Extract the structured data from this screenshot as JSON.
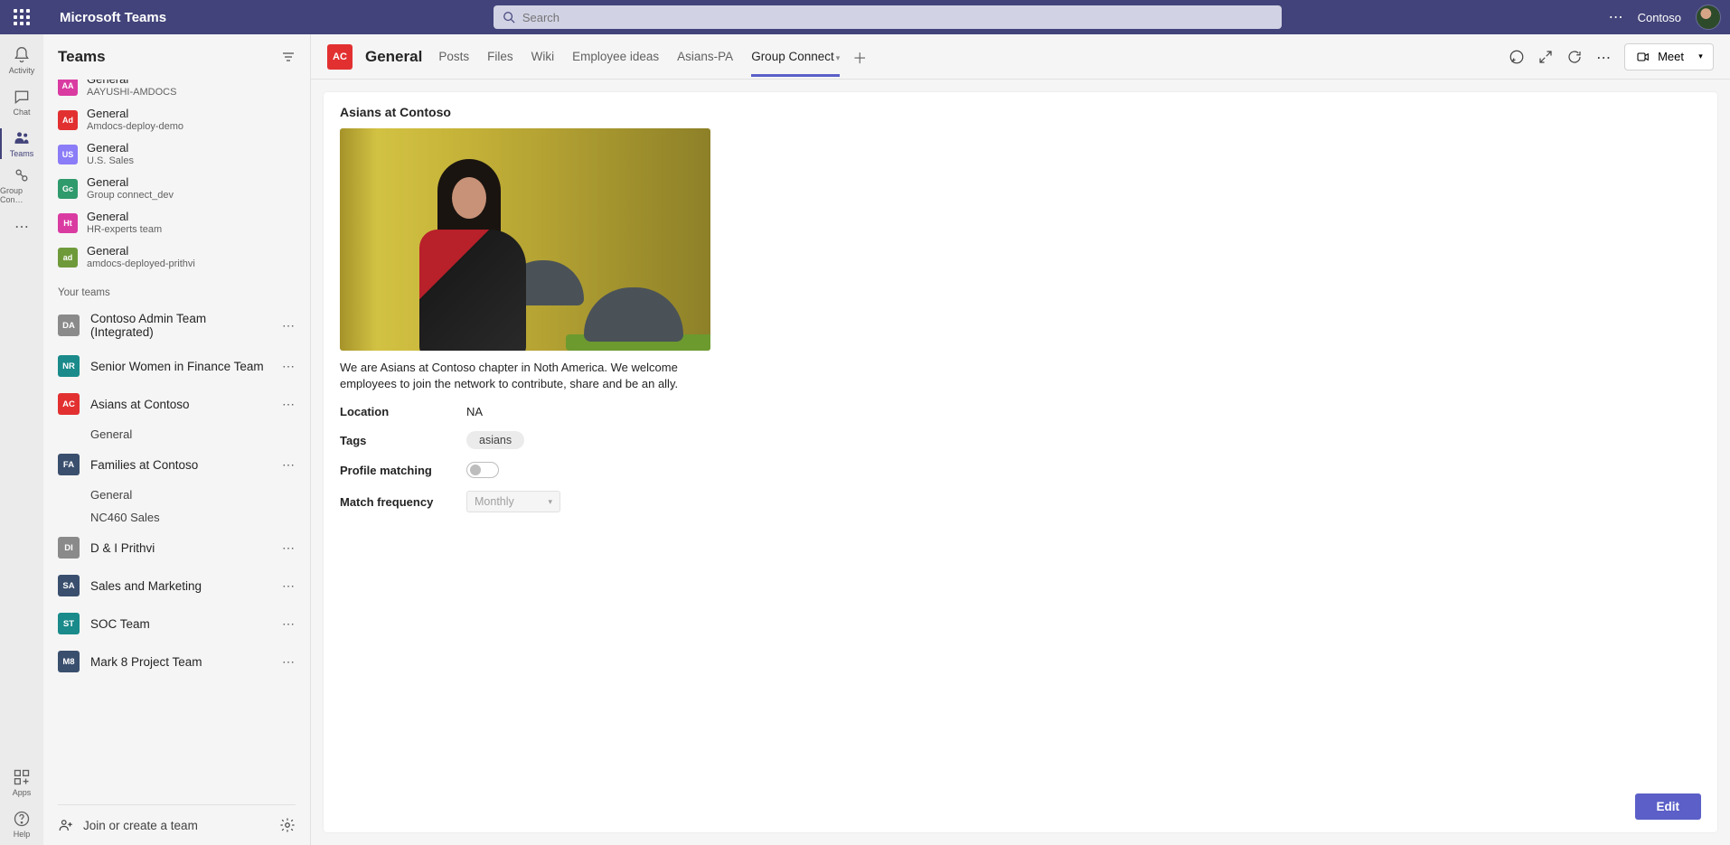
{
  "top": {
    "app_title": "Microsoft Teams",
    "search_placeholder": "Search",
    "tenant": "Contoso"
  },
  "rail": {
    "activity": "Activity",
    "chat": "Chat",
    "teams": "Teams",
    "groupcon": "Group Con…",
    "apps": "Apps",
    "help": "Help"
  },
  "panel": {
    "title": "Teams",
    "recent_channels": [
      {
        "initials": "AA",
        "color": "#d93ba1",
        "name": "General",
        "sub": "AAYUSHI-AMDOCS"
      },
      {
        "initials": "Ad",
        "color": "#e23031",
        "name": "General",
        "sub": "Amdocs-deploy-demo"
      },
      {
        "initials": "US",
        "color": "#8b7cf7",
        "name": "General",
        "sub": "U.S. Sales"
      },
      {
        "initials": "Gc",
        "color": "#2f9a6c",
        "name": "General",
        "sub": "Group connect_dev"
      },
      {
        "initials": "Ht",
        "color": "#d93ba1",
        "name": "General",
        "sub": "HR-experts team"
      },
      {
        "initials": "ad",
        "color": "#6f9a3a",
        "name": "General",
        "sub": "amdocs-deployed-prithvi"
      }
    ],
    "section_label": "Your teams",
    "teams": [
      {
        "initials": "DA",
        "color": "#8a8a8a",
        "name": "Contoso Admin Team (Integrated)",
        "channels": []
      },
      {
        "initials": "NR",
        "color": "#1a8a8a",
        "name": "Senior Women in Finance Team",
        "channels": []
      },
      {
        "initials": "AC",
        "color": "#e23031",
        "name": "Asians at Contoso",
        "channels": [
          "General"
        ]
      },
      {
        "initials": "FA",
        "color": "#3a4f6e",
        "name": "Families at Contoso",
        "channels": [
          "General",
          "NC460 Sales"
        ]
      },
      {
        "initials": "DI",
        "color": "#8a8a8a",
        "name": "D & I Prithvi",
        "channels": []
      },
      {
        "initials": "SA",
        "color": "#3a4f6e",
        "name": "Sales and Marketing",
        "channels": []
      },
      {
        "initials": "ST",
        "color": "#1a8a8a",
        "name": "SOC Team",
        "channels": []
      },
      {
        "initials": "M8",
        "color": "#3a4f6e",
        "name": "Mark 8 Project Team",
        "channels": []
      }
    ],
    "join_label": "Join or create a team"
  },
  "chanHeader": {
    "av": "AC",
    "title": "General",
    "tabs": [
      "Posts",
      "Files",
      "Wiki",
      "Employee ideas",
      "Asians-PA",
      "Group Connect"
    ],
    "active_tab": 5,
    "meet_label": "Meet"
  },
  "group": {
    "title": "Asians at Contoso",
    "description": "We are Asians at Contoso chapter in Noth America. We welcome employees to join the network to contribute, share and be an ally.",
    "location_label": "Location",
    "location_value": "NA",
    "tags_label": "Tags",
    "tags": [
      "asians"
    ],
    "profile_matching_label": "Profile matching",
    "profile_matching": false,
    "match_freq_label": "Match frequency",
    "match_freq_value": "Monthly",
    "edit_label": "Edit"
  }
}
